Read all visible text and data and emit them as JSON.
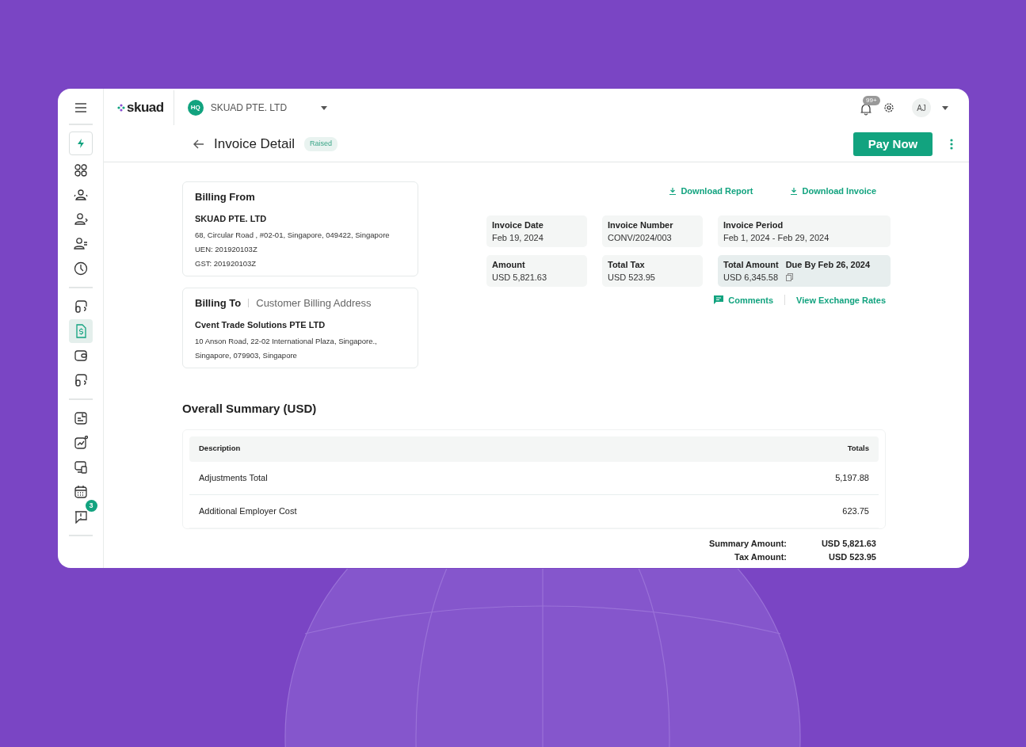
{
  "header": {
    "logo": "skuad",
    "company": {
      "initials": "HQ",
      "name": "SKUAD PTE. LTD"
    },
    "notification_count": "99+",
    "user_initials": "AJ"
  },
  "page": {
    "title": "Invoice Detail",
    "status": "Raised",
    "primary_action": "Pay Now"
  },
  "sidebar": {
    "groups": [
      [
        {
          "selected": false
        },
        {
          "selected": false
        },
        {
          "selected": false
        },
        {
          "selected": false
        },
        {
          "selected": false
        }
      ],
      [
        {
          "selected": false
        },
        {
          "selected": true
        },
        {
          "selected": false
        },
        {
          "selected": false
        }
      ],
      [
        {
          "selected": false
        },
        {
          "selected": false
        },
        {
          "selected": false
        },
        {
          "selected": false
        },
        {
          "selected": false,
          "badge": "3"
        }
      ]
    ]
  },
  "billing_from": {
    "heading": "Billing From",
    "name": "SKUAD PTE. LTD",
    "lines": [
      "68, Circular Road , #02-01, Singapore, 049422, Singapore",
      "UEN: 201920103Z",
      "GST: 201920103Z"
    ]
  },
  "billing_to": {
    "heading": "Billing To",
    "subheading": "Customer Billing Address",
    "name": "Cvent Trade Solutions PTE LTD",
    "lines": [
      "10 Anson Road, 22-02 International Plaza, Singapore.,",
      "Singapore, 079903, Singapore"
    ]
  },
  "downloads": [
    "Download Report",
    "Download Invoice"
  ],
  "details": [
    {
      "label": "Invoice Date",
      "value": "Feb 19, 2024",
      "highlighted": false
    },
    {
      "label": "Invoice Number",
      "value": "CONV/2024/003",
      "highlighted": false
    },
    {
      "label": "Invoice Period",
      "value": "Feb 1, 2024 - Feb 29, 2024",
      "highlighted": false
    },
    {
      "label": "Amount",
      "value": "USD 5,821.63",
      "highlighted": false
    },
    {
      "label": "Total Tax",
      "value": "USD 523.95",
      "highlighted": false
    },
    {
      "label": "Total Amount",
      "value": "USD 6,345.58",
      "due": "Due By Feb 26, 2024",
      "highlighted": true
    }
  ],
  "links": [
    {
      "label": "Comments",
      "kind": "comment"
    },
    {
      "label": "View Exchange Rates",
      "kind": "plain"
    }
  ],
  "summary": {
    "title": "Overall Summary (USD)",
    "columns": [
      "Description",
      "Totals"
    ],
    "rows": [
      [
        "Adjustments Total",
        "5,197.88"
      ],
      [
        "Additional Employer Cost",
        "623.75"
      ]
    ],
    "totals": [
      {
        "label": "Summary Amount:",
        "value": "USD 5,821.63"
      },
      {
        "label": "Tax Amount:",
        "value": "USD 523.95"
      }
    ]
  }
}
